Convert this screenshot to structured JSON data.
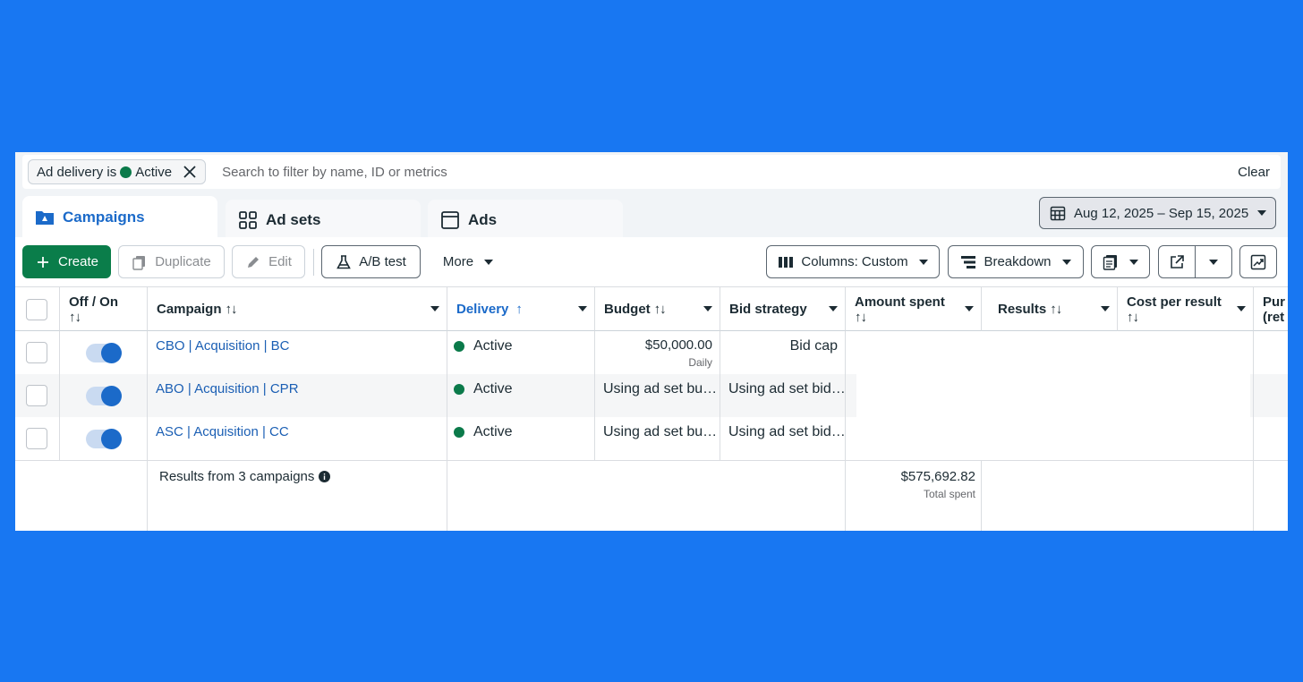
{
  "filter": {
    "chip_prefix": "Ad delivery is",
    "chip_value": "Active",
    "search_placeholder": "Search to filter by name, ID or metrics",
    "clear_label": "Clear"
  },
  "tabs": [
    {
      "label": "Campaigns",
      "active": true
    },
    {
      "label": "Ad sets",
      "active": false
    },
    {
      "label": "Ads",
      "active": false
    }
  ],
  "date_range": "Aug 12, 2025 – Sep 15, 2025",
  "toolbar": {
    "create": "Create",
    "duplicate": "Duplicate",
    "edit": "Edit",
    "ab_test": "A/B test",
    "more": "More",
    "columns": "Columns: Custom",
    "breakdown": "Breakdown"
  },
  "columns": {
    "off_on": "Off / On",
    "campaign": "Campaign",
    "delivery": "Delivery",
    "budget": "Budget",
    "bid_strategy": "Bid strategy",
    "amount_spent": "Amount spent",
    "results": "Results",
    "cost_per_result": "Cost per result",
    "purchase_roas_partial": "Pur",
    "purchase_roas_partial2": "(ret",
    "sort_glyph": "↑↓",
    "sort_up_glyph": "↑"
  },
  "rows": [
    {
      "campaign": "CBO | Acquisition | BC",
      "delivery": "Active",
      "budget": "$50,000.00",
      "budget_sub": "Daily",
      "bid": "Bid cap"
    },
    {
      "campaign": "ABO | Acquisition | CPR",
      "delivery": "Active",
      "budget": "Using ad set bu…",
      "budget_sub": "",
      "bid": "Using ad set bid…"
    },
    {
      "campaign": "ASC | Acquisition | CC",
      "delivery": "Active",
      "budget": "Using ad set bu…",
      "budget_sub": "",
      "bid": "Using ad set bid…"
    }
  ],
  "summary": {
    "label": "Results from 3 campaigns",
    "amount_spent": "$575,692.82",
    "amount_spent_sub": "Total spent"
  },
  "colors": {
    "brand_bg": "#1877F2",
    "accent_blue": "#1b6ac9",
    "create_green": "#0a7d4a",
    "active_dot": "#0b7a4a"
  }
}
